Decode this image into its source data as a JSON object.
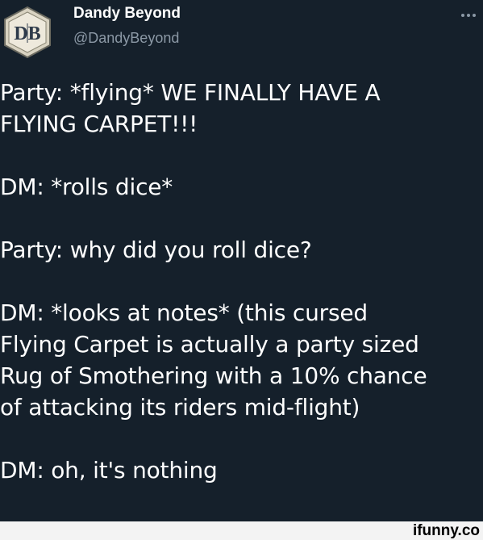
{
  "tweet": {
    "author_name": "Dandy Beyond",
    "author_handle": "@DandyBeyond",
    "avatar_letters": "DB",
    "more_icon": "more-horizontal-icon",
    "lines": [
      "Party: *flying* WE FINALLY HAVE A",
      "FLYING CARPET!!!",
      "",
      "DM: *rolls dice*",
      "",
      "Party: why did you roll dice?",
      "",
      "DM: *looks at notes* (this cursed",
      "Flying Carpet is actually a party sized",
      "Rug of Smothering with a 10% chance",
      "of attacking its riders mid-flight)",
      "",
      "DM: oh, it's nothing"
    ]
  },
  "watermark": {
    "text": "ifunny.co"
  },
  "colors": {
    "background": "#15202b",
    "text": "#ffffff",
    "handle": "#8b98a5",
    "watermark_bg": "#f3f3f3"
  }
}
